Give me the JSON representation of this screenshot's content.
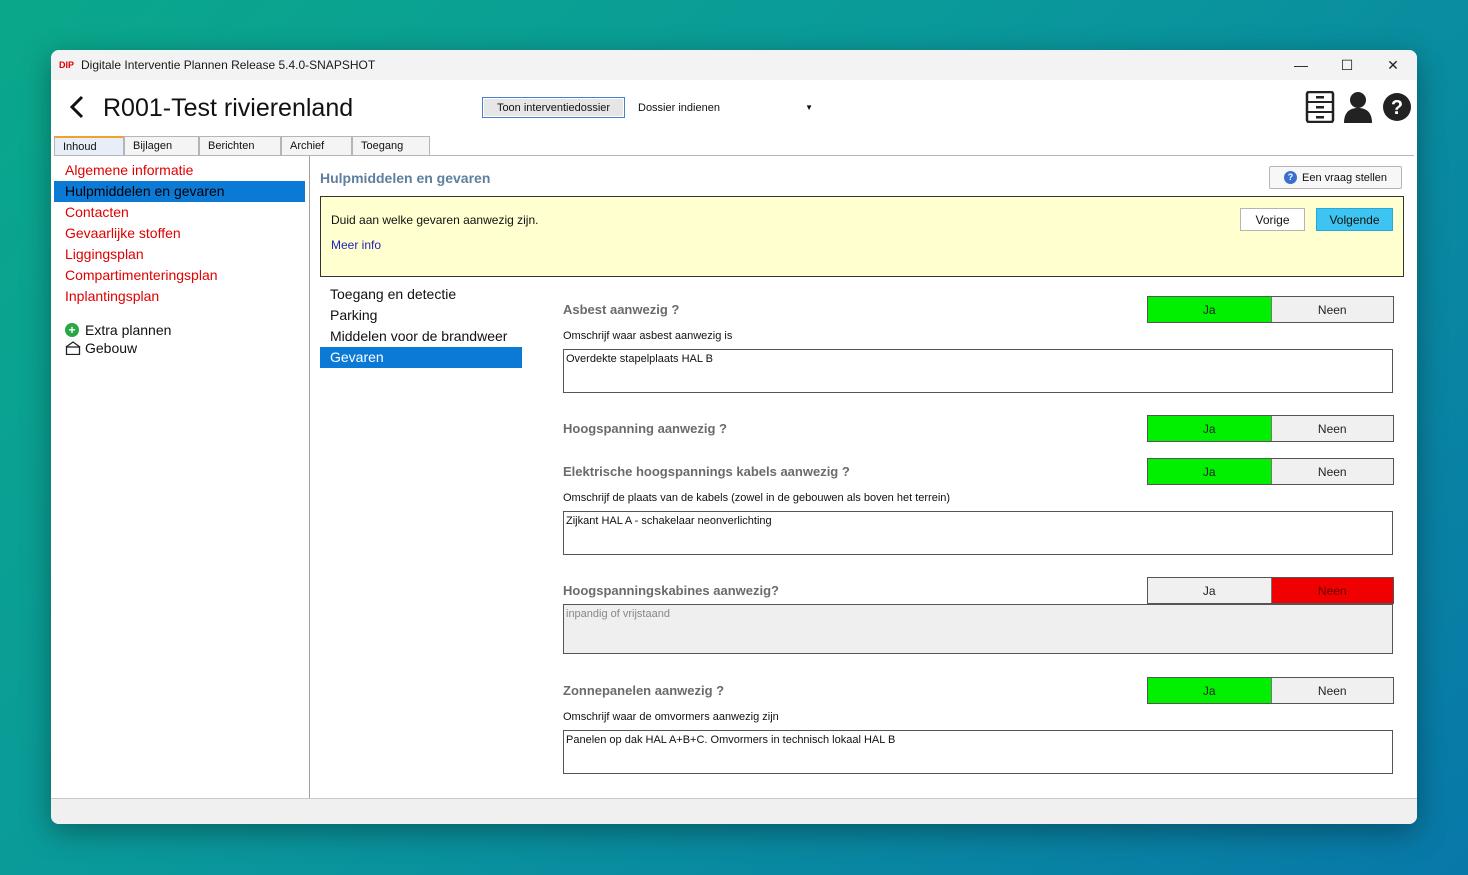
{
  "window": {
    "title": "Digitale Interventie Plannen Release 5.4.0-SNAPSHOT",
    "controls": {
      "minimize": "—",
      "maximize": "☐",
      "close": "✕"
    }
  },
  "header": {
    "back": "‹",
    "title": "R001-Test rivierenland",
    "show_dossier_button": "Toon interventiedossier",
    "dossier_select": "Dossier indienen",
    "icons": [
      "cabinet-icon",
      "user-icon",
      "help-icon"
    ]
  },
  "tabs": [
    "Inhoud",
    "Bijlagen",
    "Berichten",
    "Archief",
    "Toegang"
  ],
  "sidebar": {
    "items": [
      "Algemene informatie",
      "Hulpmiddelen en gevaren",
      "Contacten",
      "Gevaarlijke stoffen",
      "Liggingsplan",
      "Compartimenteringsplan",
      "Inplantingsplan"
    ],
    "extra_plannen": "Extra plannen",
    "gebouw": "Gebouw"
  },
  "content": {
    "title": "Hulpmiddelen en gevaren",
    "ask_button": "Een vraag stellen",
    "info": {
      "text": "Duid aan welke gevaren aanwezig zijn.",
      "more": "Meer info",
      "prev": "Vorige",
      "next": "Volgende"
    },
    "subnav": [
      "Toegang en detectie",
      "Parking",
      "Middelen voor de brandweer",
      "Gevaren"
    ],
    "questions": {
      "asbest": {
        "label": "Asbest aanwezig ?",
        "yes": "Ja",
        "no": "Neen",
        "selected": "Ja",
        "sub": "Omschrijf waar asbest aanwezig is",
        "value": "Overdekte stapelplaats HAL B"
      },
      "hoogspanning": {
        "label": "Hoogspanning aanwezig ?",
        "yes": "Ja",
        "no": "Neen",
        "selected": "Ja"
      },
      "kabels": {
        "label": "Elektrische hoogspannings kabels aanwezig ?",
        "yes": "Ja",
        "no": "Neen",
        "selected": "Ja",
        "sub": "Omschrijf de plaats van de kabels (zowel in de gebouwen als boven het terrein)",
        "value": "Zijkant HAL A - schakelaar neonverlichting"
      },
      "kabines": {
        "label": "Hoogspanningskabines aanwezig?",
        "yes": "Ja",
        "no": "Neen",
        "selected": "Neen",
        "placeholder": "inpandig of vrijstaand"
      },
      "zonnepanelen": {
        "label": "Zonnepanelen aanwezig ?",
        "yes": "Ja",
        "no": "Neen",
        "selected": "Ja",
        "sub": "Omschrijf waar de omvormers aanwezig zijn",
        "value": "Panelen op dak HAL A+B+C.  Omvormers in technisch lokaal HAL B"
      }
    }
  },
  "colors": {
    "selected_yes": "#00f000",
    "selected_no": "#f00000",
    "nav_link": "#e00000",
    "selection": "#0b7ad6",
    "info_bg": "#ffffd0",
    "next_button": "#3ec4f0"
  }
}
